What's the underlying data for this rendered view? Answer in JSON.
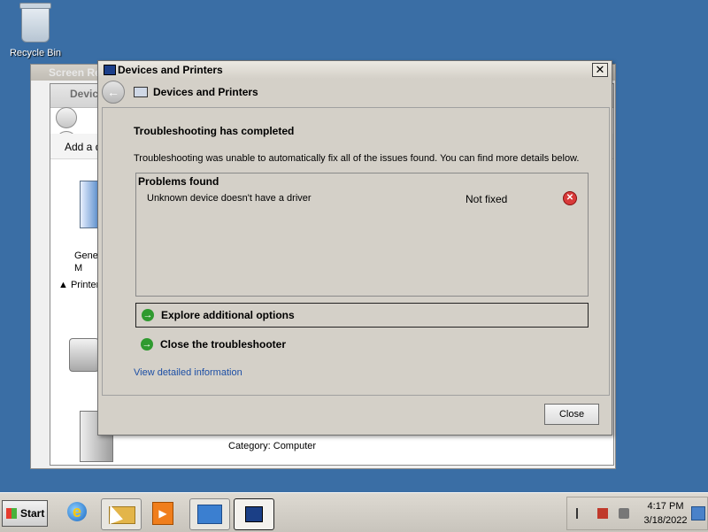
{
  "desktop": {
    "recycle_bin_label": "Recycle Bin"
  },
  "background_windows": {
    "screen_res_title": "Screen Re",
    "devices_title": "Devic",
    "toolbar_text": "Add a de",
    "generic_label": "Gene\nM",
    "printers_label": "▲ Printers",
    "category_text": "Category: Computer"
  },
  "dialog": {
    "title": "Devices and Printers",
    "header": "Devices and Printers",
    "heading": "Troubleshooting has completed",
    "description": "Troubleshooting was unable to automatically fix all of the issues found. You can find more details below.",
    "problems_title": "Problems found",
    "problem": {
      "text": "Unknown device doesn't have a driver",
      "status": "Not fixed"
    },
    "option_explore": "Explore additional options",
    "option_close": "Close the troubleshooter",
    "link_details": "View detailed information",
    "close_button": "Close",
    "close_glyph": "✕"
  },
  "taskbar": {
    "start_label": "Start",
    "time": "4:17 PM",
    "date": "3/18/2022"
  },
  "colors": {
    "desktop": "#3a6ea5",
    "dialog": "#d4d0c8",
    "link": "#1d4fa5",
    "arrow": "#2f9a2f",
    "error": "#d83a3a"
  }
}
